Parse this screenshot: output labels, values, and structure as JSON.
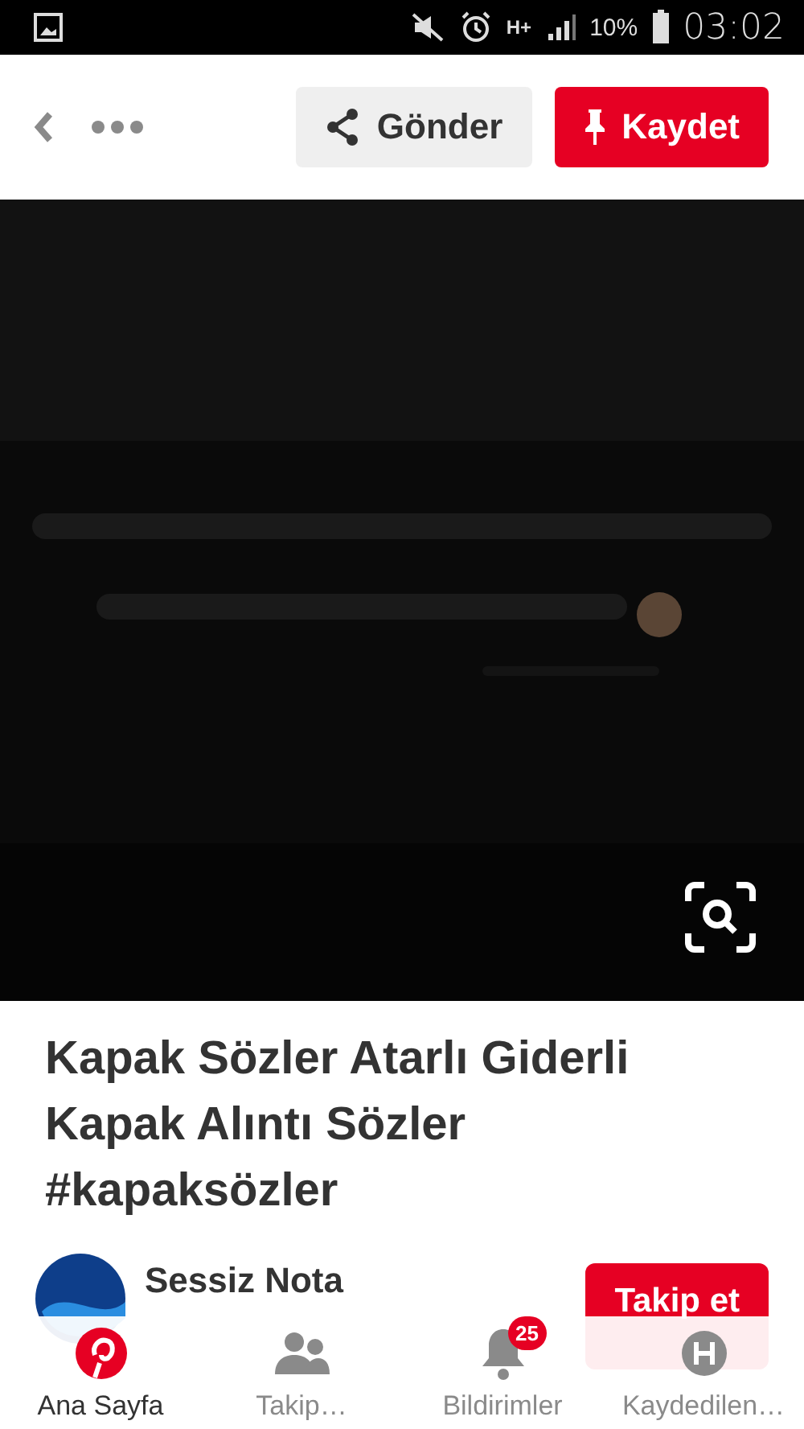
{
  "status_bar": {
    "network": "H+",
    "battery": "10%",
    "time": "03:02"
  },
  "toolbar": {
    "share_button": "Gönder",
    "save_button": "Kaydet"
  },
  "pin": {
    "title": "Kapak Sözler Atarlı Giderli Kapak Alıntı Sözler #kapaksözler"
  },
  "author": {
    "name": "Sessiz Nota",
    "follow_button": "Takip et"
  },
  "bottom_nav": [
    {
      "label": "Ana Sayfa",
      "kind": "home",
      "selected": true
    },
    {
      "label": "Takip…",
      "kind": "following",
      "selected": false
    },
    {
      "label": "Bildirimler",
      "kind": "notifications",
      "selected": false,
      "badge": "25"
    },
    {
      "label": "Kaydedilen…",
      "kind": "saved",
      "selected": false
    }
  ]
}
